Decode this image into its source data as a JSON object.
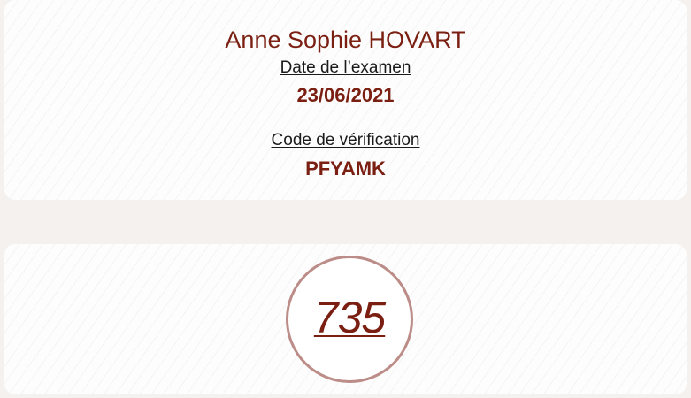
{
  "candidate": {
    "name": "Anne Sophie HOVART"
  },
  "exam": {
    "date_label": "Date de l’examen",
    "date_value": "23/06/2021",
    "code_label": "Code de vérification",
    "code_value": "PFYAMK"
  },
  "score": {
    "value": "735"
  },
  "colors": {
    "accent": "#7a1f12",
    "circle_border": "#bc8d88",
    "background": "#f5f1ef",
    "card": "#fdfdfd"
  }
}
